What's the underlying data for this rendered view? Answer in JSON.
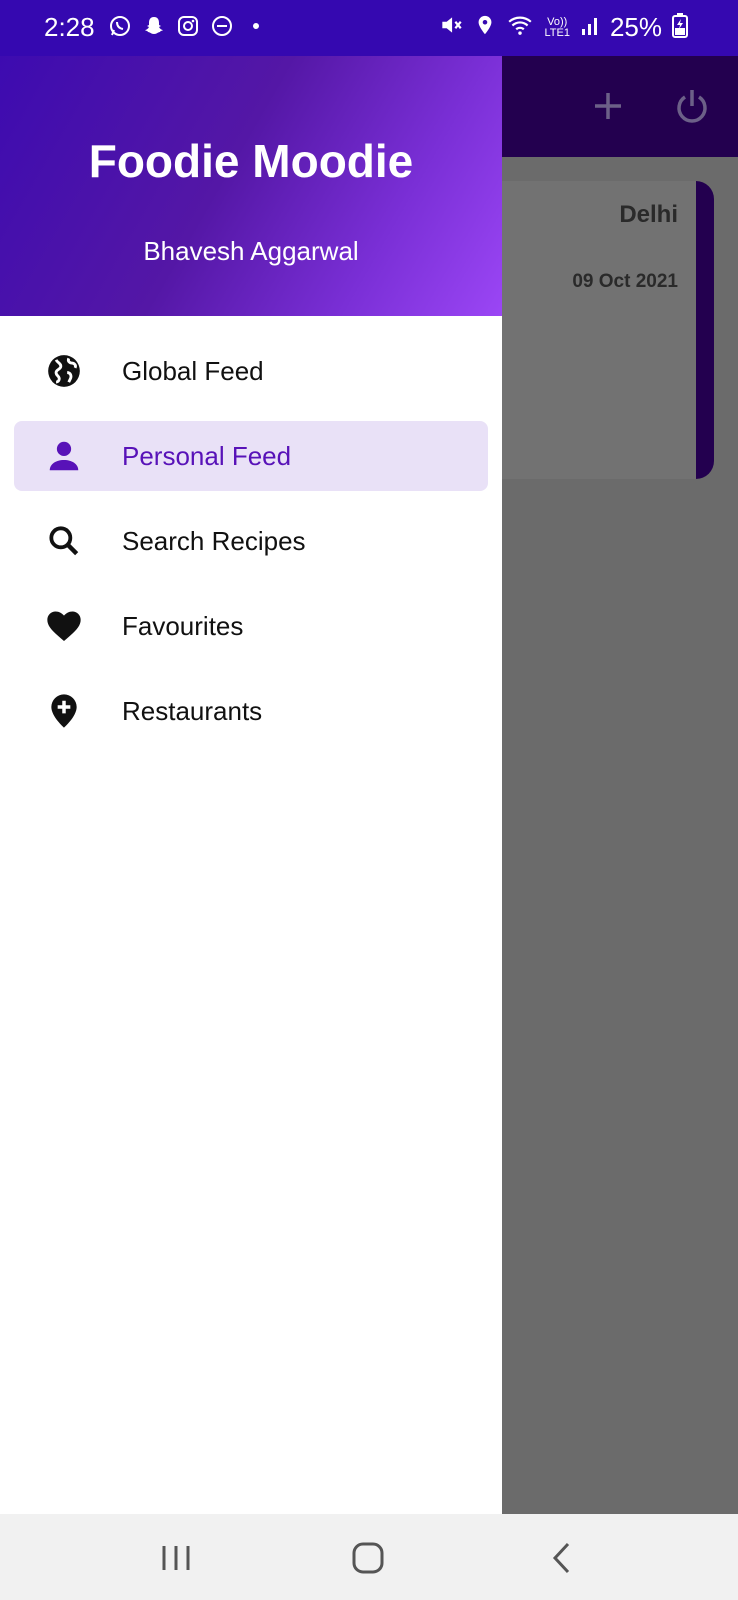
{
  "status_bar": {
    "time": "2:28",
    "left_icons": [
      "whatsapp-icon",
      "snapchat-icon",
      "instagram-icon",
      "do-not-disturb-icon",
      "dot-icon"
    ],
    "right_icons": [
      "mute-icon",
      "location-icon",
      "wifi-icon",
      "signal-icon",
      "battery-icon"
    ],
    "volte_top": "Vo))",
    "volte_bottom": "LTE1",
    "battery": "25%"
  },
  "background_screen": {
    "toolbar_actions": [
      "add-icon",
      "power-icon"
    ],
    "card": {
      "title": "Delhi",
      "date": "09 Oct 2021"
    }
  },
  "drawer": {
    "header": {
      "title": "Foodie Moodie",
      "subtitle": "Bhavesh Aggarwal"
    },
    "items": [
      {
        "label": "Global Feed",
        "icon": "globe-icon",
        "active": false
      },
      {
        "label": "Personal Feed",
        "icon": "person-icon",
        "active": true
      },
      {
        "label": "Search Recipes",
        "icon": "search-icon",
        "active": false
      },
      {
        "label": "Favourites",
        "icon": "heart-icon",
        "active": false
      },
      {
        "label": "Restaurants",
        "icon": "location-add-icon",
        "active": false
      }
    ]
  },
  "colors": {
    "status_bar": "#3508b0",
    "accent": "#5812b8",
    "active_bg": "#e9e1f7",
    "scrim": "#6b6b6b"
  },
  "nav_bar": [
    "recents-icon",
    "home-icon",
    "back-icon"
  ]
}
